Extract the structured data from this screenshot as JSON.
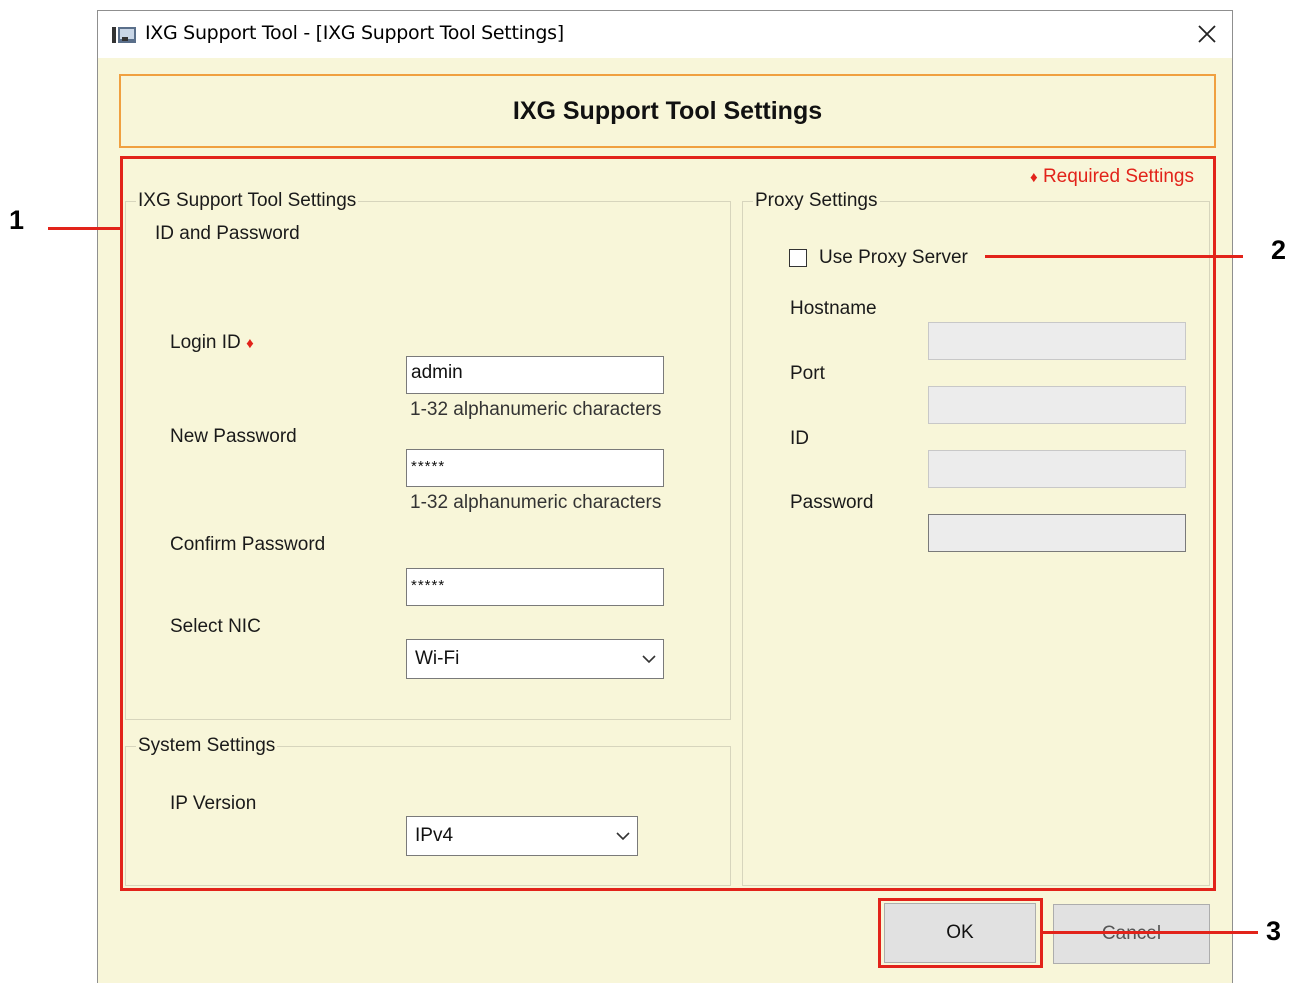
{
  "window": {
    "title": "IXG Support Tool - [IXG Support Tool Settings]",
    "close_label": "✕"
  },
  "header": {
    "title": "IXG Support Tool Settings"
  },
  "required_note": {
    "marker": "♦",
    "text": "Required Settings"
  },
  "support_group": {
    "legend": "IXG Support Tool Settings",
    "subheading": "ID and Password",
    "login_id": {
      "label": "Login ID",
      "required_marker": "♦",
      "value": "admin",
      "hint": "1-32 alphanumeric characters"
    },
    "new_password": {
      "label": "New Password",
      "value": "*****",
      "hint": "1-32 alphanumeric characters"
    },
    "confirm_password": {
      "label": "Confirm Password",
      "value": "*****"
    },
    "select_nic": {
      "label": "Select NIC",
      "value": "Wi-Fi"
    }
  },
  "system_group": {
    "legend": "System Settings",
    "ip_version": {
      "label": "IP Version",
      "value": "IPv4"
    }
  },
  "proxy_group": {
    "legend": "Proxy Settings",
    "use_proxy": {
      "label": "Use Proxy Server",
      "checked": false
    },
    "hostname_label": "Hostname",
    "port_label": "Port",
    "id_label": "ID",
    "password_label": "Password"
  },
  "buttons": {
    "ok": "OK",
    "cancel": "Cancel"
  },
  "callouts": {
    "c1": "1",
    "c2": "2",
    "c3": "3"
  },
  "colors": {
    "callout_red": "#e2231a",
    "header_border": "#f0a040",
    "window_bg": "#f8f6d9"
  }
}
